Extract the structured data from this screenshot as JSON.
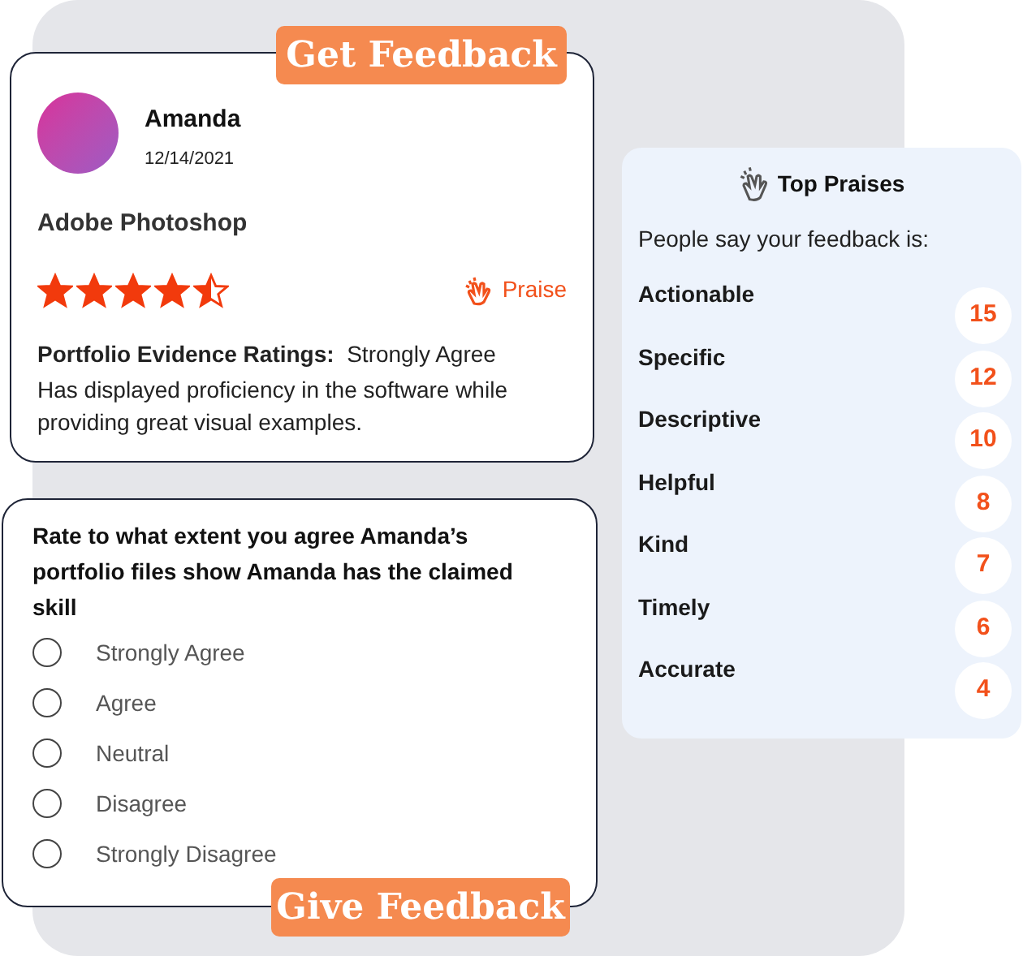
{
  "get_feedback_card": {
    "badge": "Get Feedback",
    "reviewer": {
      "name": "Amanda",
      "date": "12/14/2021"
    },
    "skill": "Adobe Photoshop",
    "stars": 4.5,
    "praise_label": "Praise",
    "rating_label": "Portfolio Evidence Ratings:",
    "rating_value": "Strongly Agree",
    "comment": "Has displayed proficiency in the software while providing great visual examples."
  },
  "top_praises": {
    "title": "Top Praises",
    "subtitle": "People say your feedback is:",
    "items": [
      {
        "label": "Actionable",
        "count": "15"
      },
      {
        "label": "Specific",
        "count": "12"
      },
      {
        "label": "Descriptive",
        "count": "10"
      },
      {
        "label": "Helpful",
        "count": "8"
      },
      {
        "label": "Kind",
        "count": "7"
      },
      {
        "label": "Timely",
        "count": "6"
      },
      {
        "label": "Accurate",
        "count": "4"
      }
    ]
  },
  "give_feedback_card": {
    "question": "Rate to what extent you agree Amanda’s portfolio files show Amanda has the claimed skill",
    "options": [
      {
        "label": "Strongly Agree",
        "selected": false
      },
      {
        "label": "Agree",
        "selected": false
      },
      {
        "label": "Neutral",
        "selected": false
      },
      {
        "label": "Disagree",
        "selected": false
      },
      {
        "label": "Strongly Disagree",
        "selected": false
      }
    ],
    "badge": "Give Feedback"
  }
}
